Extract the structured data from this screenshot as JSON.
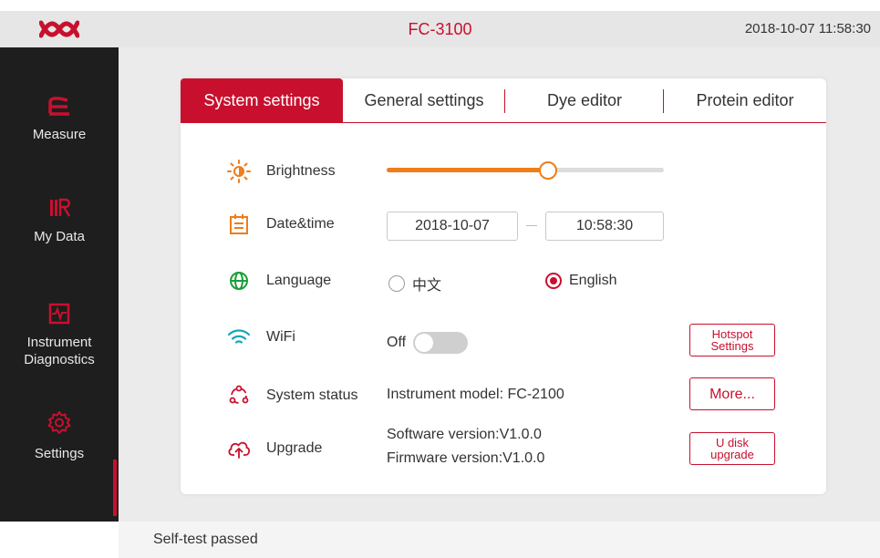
{
  "header": {
    "title": "FC-3100",
    "datetime": "2018-10-07  11:58:30",
    "logo": "brand-logo"
  },
  "sidebar": {
    "items": [
      {
        "label": "Measure",
        "icon": "measure-icon"
      },
      {
        "label": "My Data",
        "icon": "my-data-icon"
      },
      {
        "label": "Instrument Diagnostics",
        "icon": "diagnostics-icon"
      },
      {
        "label": "Settings",
        "icon": "settings-icon",
        "active": true
      }
    ]
  },
  "tabs": [
    {
      "label": "System settings",
      "active": true
    },
    {
      "label": "General settings"
    },
    {
      "label": "Dye editor"
    },
    {
      "label": "Protein editor"
    }
  ],
  "settings": {
    "brightness": {
      "label": "Brightness",
      "value": 0.58
    },
    "datetime": {
      "label": "Date&time",
      "date": "2018-10-07",
      "time": "10:58:30"
    },
    "language": {
      "label": "Language",
      "options": [
        "中文",
        "English"
      ],
      "selected": "English"
    },
    "wifi": {
      "label": "WiFi",
      "state": "Off",
      "hotspot_button": "Hotspot Settings"
    },
    "system_status": {
      "label": "System status",
      "model": "Instrument model: FC-2100",
      "more_button": "More..."
    },
    "upgrade": {
      "label": "Upgrade",
      "software": "Software version:V1.0.0",
      "firmware": "Firmware version:V1.0.0",
      "button": "U disk upgrade"
    }
  },
  "statusbar": {
    "text": "Self-test passed"
  },
  "colors": {
    "accent": "#c8102e",
    "slider": "#ee7d1a",
    "sidebar": "#1e1e1e",
    "wifi": "#1aa6b7",
    "language": "#1a9e3a"
  }
}
